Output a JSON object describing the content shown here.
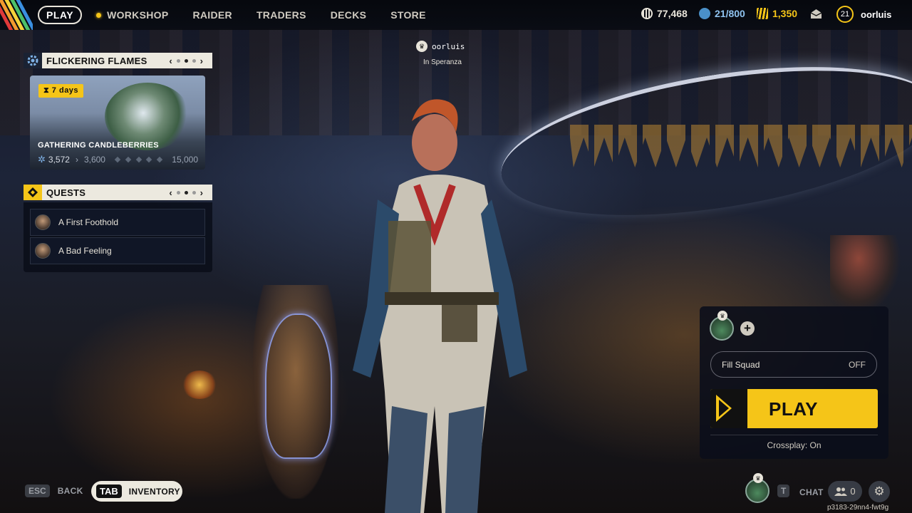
{
  "topbar": {
    "nav": {
      "play": "PLAY",
      "workshop": "WORKSHOP",
      "raider": "RAIDER",
      "traders": "TRADERS",
      "decks": "DECKS",
      "store": "STORE"
    },
    "currencies": {
      "coins": "77,468",
      "credits": "21/800",
      "tokens": "1,350"
    },
    "level": "21",
    "username": "oorluis",
    "stripe_colors": [
      "#e03a3a",
      "#f29a2e",
      "#f5d33a",
      "#4cc06a",
      "#3a8fe0"
    ]
  },
  "event_panel": {
    "title": "FLICKERING FLAMES",
    "page": 2,
    "pages": 3,
    "days_badge": "7 days",
    "event_name": "GATHERING CANDLEBERRIES",
    "progress_current": "3,572",
    "progress_next": "3,600",
    "progress_max": "15,000"
  },
  "quests_panel": {
    "title": "QUESTS",
    "page": 2,
    "pages": 3,
    "items": [
      {
        "label": "A First Foothold"
      },
      {
        "label": "A Bad Feeling"
      }
    ]
  },
  "player_tag": {
    "name": "oorluis",
    "location": "In Speranza"
  },
  "squad_panel": {
    "fill_squad_label": "Fill Squad",
    "fill_squad_value": "OFF",
    "play_label": "PLAY",
    "crossplay": "Crossplay: On"
  },
  "bottombar": {
    "back_key": "ESC",
    "back_label": "BACK",
    "inventory_key": "TAB",
    "inventory_label": "INVENTORY",
    "chat_key": "T",
    "chat_label": "CHAT",
    "friends_count": "0",
    "build_id": "p3183-29nn4-fwt9g"
  },
  "colors": {
    "accent_yellow": "#f5c518",
    "panel_header": "#ece9df",
    "panel_dark": "#0a0e1a"
  }
}
